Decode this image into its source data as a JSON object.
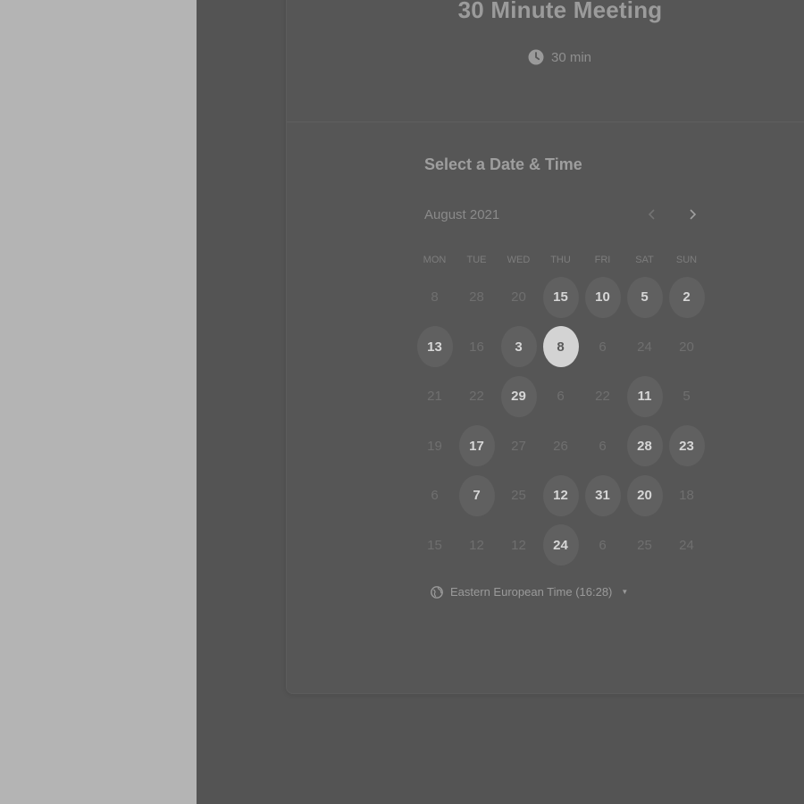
{
  "event": {
    "title": "30 Minute Meeting",
    "duration": "30 min"
  },
  "calendar": {
    "section_title": "Select a Date & Time",
    "month": "August 2021",
    "weekdays": [
      "MON",
      "TUE",
      "WED",
      "THU",
      "FRI",
      "SAT",
      "SUN"
    ],
    "weeks": [
      [
        {
          "d": "8"
        },
        {
          "d": "28"
        },
        {
          "d": "20"
        },
        {
          "d": "15",
          "available": true
        },
        {
          "d": "10",
          "available": true
        },
        {
          "d": "5",
          "available": true
        },
        {
          "d": "2",
          "available": true
        }
      ],
      [
        {
          "d": "13",
          "available": true
        },
        {
          "d": "16"
        },
        {
          "d": "3",
          "available": true
        },
        {
          "d": "8",
          "available": true,
          "selected": true
        },
        {
          "d": "6"
        },
        {
          "d": "24"
        },
        {
          "d": "20"
        }
      ],
      [
        {
          "d": "21"
        },
        {
          "d": "22"
        },
        {
          "d": "29",
          "available": true
        },
        {
          "d": "6"
        },
        {
          "d": "22"
        },
        {
          "d": "11",
          "available": true
        },
        {
          "d": "5"
        }
      ],
      [
        {
          "d": "19"
        },
        {
          "d": "17",
          "available": true
        },
        {
          "d": "27"
        },
        {
          "d": "26"
        },
        {
          "d": "6"
        },
        {
          "d": "28",
          "available": true
        },
        {
          "d": "23",
          "available": true
        }
      ],
      [
        {
          "d": "6"
        },
        {
          "d": "7",
          "available": true
        },
        {
          "d": "25"
        },
        {
          "d": "12",
          "available": true
        },
        {
          "d": "31",
          "available": true
        },
        {
          "d": "20",
          "available": true
        },
        {
          "d": "18"
        }
      ],
      [
        {
          "d": "15"
        },
        {
          "d": "12"
        },
        {
          "d": "12"
        },
        {
          "d": "24",
          "available": true
        },
        {
          "d": "6"
        },
        {
          "d": "25"
        },
        {
          "d": "24"
        }
      ]
    ]
  },
  "timezone": {
    "label": "Eastern European Time (16:28)"
  },
  "icons": {
    "clock": "clock-icon",
    "globe": "globe-icon",
    "prev": "chevron-left-icon",
    "next": "chevron-right-icon",
    "caret": "caret-down-icon"
  },
  "colors": {
    "left_pane": "#b4b4b4",
    "background": "#545454",
    "available_day": "#606060",
    "selected_day": "#d3d3d3"
  }
}
